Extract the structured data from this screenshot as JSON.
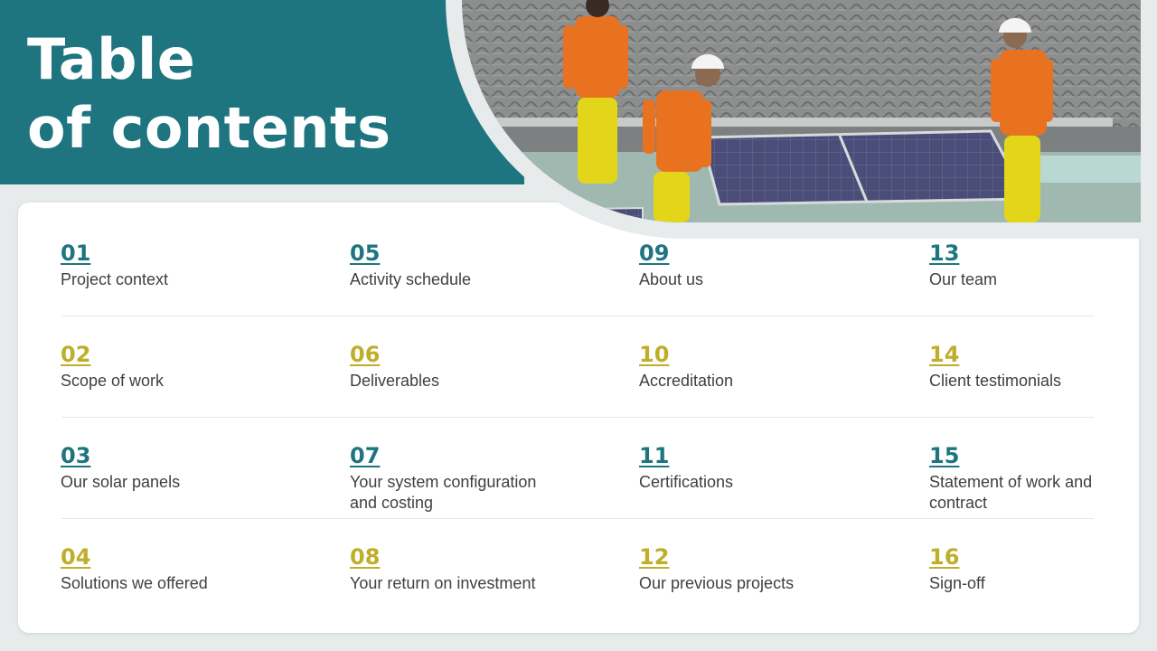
{
  "header": {
    "title_line1": "Table",
    "title_line2": "of contents"
  },
  "colors": {
    "teal": "#1e7580",
    "gold": "#bfae2a",
    "text": "#404040"
  },
  "photo": {
    "description_icon": "solar-installation-photo"
  },
  "items": [
    {
      "number": "01",
      "label": "Project context",
      "color": "teal"
    },
    {
      "number": "02",
      "label": "Scope of work",
      "color": "gold"
    },
    {
      "number": "03",
      "label": "Our solar panels",
      "color": "teal"
    },
    {
      "number": "04",
      "label": "Solutions we offered",
      "color": "gold"
    },
    {
      "number": "05",
      "label": "Activity schedule",
      "color": "teal"
    },
    {
      "number": "06",
      "label": "Deliverables",
      "color": "gold"
    },
    {
      "number": "07",
      "label": "Your system configuration and costing",
      "color": "teal"
    },
    {
      "number": "08",
      "label": "Your return on investment",
      "color": "gold"
    },
    {
      "number": "09",
      "label": "About us",
      "color": "teal"
    },
    {
      "number": "10",
      "label": "Accreditation",
      "color": "gold"
    },
    {
      "number": "11",
      "label": "Certifications",
      "color": "teal"
    },
    {
      "number": "12",
      "label": "Our previous projects",
      "color": "gold"
    },
    {
      "number": "13",
      "label": "Our team",
      "color": "teal"
    },
    {
      "number": "14",
      "label": "Client testimonials",
      "color": "gold"
    },
    {
      "number": "15",
      "label": "Statement of work and contract",
      "color": "teal"
    },
    {
      "number": "16",
      "label": "Sign-off",
      "color": "gold"
    }
  ]
}
